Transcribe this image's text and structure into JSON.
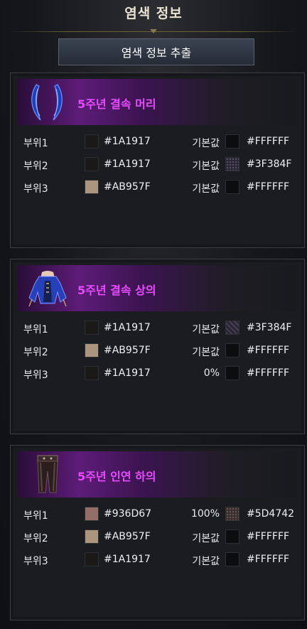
{
  "header": {
    "title": "염색 정보"
  },
  "extract_button": {
    "label": "염색 정보 추출"
  },
  "items": [
    {
      "name": "5주년 결속 머리",
      "icon": "horns-icon",
      "parts": [
        {
          "label": "부위1",
          "color_a": "#1A1917",
          "value": "기본값",
          "color_b": "#FFFFFF"
        },
        {
          "label": "부위2",
          "color_a": "#1A1917",
          "value": "기본값",
          "color_b": "#3F384F"
        },
        {
          "label": "부위3",
          "color_a": "#AB957F",
          "value": "기본값",
          "color_b": "#FFFFFF"
        }
      ]
    },
    {
      "name": "5주년 결속 상의",
      "icon": "dress-top-icon",
      "parts": [
        {
          "label": "부위1",
          "color_a": "#1A1917",
          "value": "기본값",
          "color_b": "#3F384F"
        },
        {
          "label": "부위2",
          "color_a": "#AB957F",
          "value": "기본값",
          "color_b": "#FFFFFF"
        },
        {
          "label": "부위3",
          "color_a": "#1A1917",
          "value": "0%",
          "color_b": "#FFFFFF"
        }
      ]
    },
    {
      "name": "5주년 인연 하의",
      "icon": "pants-icon",
      "parts": [
        {
          "label": "부위1",
          "color_a": "#936D67",
          "value": "100%",
          "color_b": "#5D4742"
        },
        {
          "label": "부위2",
          "color_a": "#AB957F",
          "value": "기본값",
          "color_b": "#FFFFFF"
        },
        {
          "label": "부위3",
          "color_a": "#1A1917",
          "value": "기본값",
          "color_b": "#FFFFFF"
        }
      ]
    }
  ]
}
